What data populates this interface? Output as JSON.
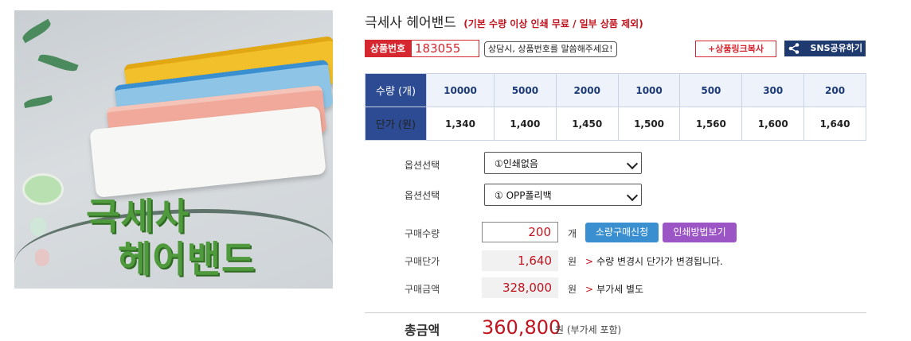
{
  "product": {
    "title": "극세사 헤어밴드",
    "subtitle": "(기본 수량 이상 인쇄 무료 / 일부 상품 제외)",
    "image_caption_line1": "극세사",
    "image_caption_line2": "헤어밴드",
    "code_label": "상품번호",
    "code_value": "183055",
    "code_note": "상담시, 상품번호를 말씀해주세요!",
    "link_button": "+상품링크복사",
    "sns_button": "SNS공유하기"
  },
  "price_table": {
    "qty_header": "수량 (개)",
    "price_header": "단가 (원)",
    "quantities": [
      "10000",
      "5000",
      "2000",
      "1000",
      "500",
      "300",
      "200"
    ],
    "prices": [
      "1,340",
      "1,400",
      "1,450",
      "1,500",
      "1,560",
      "1,600",
      "1,640"
    ]
  },
  "options": [
    {
      "label": "옵션선택",
      "value": "①인쇄없음"
    },
    {
      "label": "옵션선택",
      "value": "① OPP폴리백"
    }
  ],
  "order": {
    "qty_label": "구매수량",
    "qty_value": "200",
    "qty_unit": "개",
    "small_order_button": "소량구매신청",
    "print_method_button": "인쇄방법보기",
    "unit_price_label": "구매단가",
    "unit_price_value": "1,640",
    "unit_price_unit": "원",
    "unit_price_note": "수량 변경시 단가가 변경됩니다.",
    "amount_label": "구매금액",
    "amount_value": "328,000",
    "amount_unit": "원",
    "amount_note": "부가세 별도",
    "note_arrow": ">",
    "total_label": "총금액",
    "total_value": "360,800",
    "total_unit": "원 (부가세 포함)"
  },
  "colors": {
    "accent_red": "#c0141e",
    "table_header_blue": "#2d4b93",
    "button_blue": "#3a8fd0",
    "button_purple": "#9b55c5",
    "sns_navy": "#1e3a6e"
  }
}
